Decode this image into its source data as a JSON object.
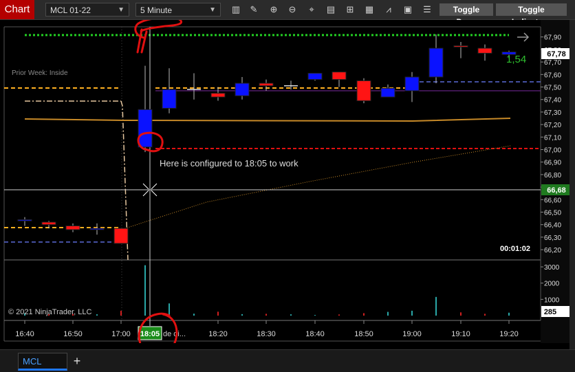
{
  "toolbar": {
    "chart_label": "Chart",
    "instrument": "MCL 01-22",
    "interval": "5 Minute",
    "toggle_draw_label": "Toggle Draw",
    "toggle_indicators_label": "Toggle Indicators",
    "icons": [
      "bar-type-icon",
      "pencil-icon",
      "zoom-in-icon",
      "zoom-out-icon",
      "crosshair-icon",
      "data-box-icon",
      "strategy-icon",
      "chart-style-icon",
      "properties-icon",
      "more-menu-icon"
    ]
  },
  "chart": {
    "prior_week_label": "Prior Week: Inside",
    "annotation": "Here is configured to 18:05 to work",
    "copyright": "© 2021 NinjaTrader, LLC",
    "countdown": "00:01:02",
    "cursor_time": "18:05",
    "cursor_time_suffix": "de di...",
    "change_value": "1,54",
    "price_labels": [
      "67,90",
      "67,80",
      "67,70",
      "67,60",
      "67,50",
      "67,40",
      "67,30",
      "67,20",
      "67,10",
      "67,00",
      "66,90",
      "66,80",
      "66,70",
      "66,60",
      "66,50",
      "66,40",
      "66,30",
      "66,20"
    ],
    "last_price": "67,78",
    "crosshair_price": "66,68",
    "volume_labels": [
      "3000",
      "2000",
      "1000"
    ],
    "volume_current": "285",
    "time_labels": [
      "16:40",
      "16:50",
      "17:00",
      "18:20",
      "18:30",
      "18:40",
      "18:50",
      "19:00",
      "19:10",
      "19:20"
    ],
    "colors": {
      "up": "#0a12ff",
      "down": "#ff1414",
      "last_price_badge": "#1f7a1f"
    }
  },
  "chart_data": {
    "type": "candlestick",
    "y_price_range": [
      66.14,
      67.97
    ],
    "candles": [
      {
        "o": 66.43,
        "h": 66.46,
        "l": 66.39,
        "c": 66.44
      },
      {
        "o": 66.42,
        "h": 66.43,
        "l": 66.37,
        "c": 66.4
      },
      {
        "o": 66.39,
        "h": 66.41,
        "l": 66.34,
        "c": 66.36
      },
      {
        "o": 66.36,
        "h": 66.41,
        "l": 66.32,
        "c": 66.37
      },
      {
        "o": 66.37,
        "h": 66.37,
        "l": 66.25,
        "c": 66.25
      },
      {
        "o": 67.02,
        "h": 67.67,
        "l": 66.98,
        "c": 67.32
      },
      {
        "o": 67.33,
        "h": 67.65,
        "l": 67.29,
        "c": 67.48
      },
      {
        "o": 67.48,
        "h": 67.61,
        "l": 67.4,
        "c": 67.48
      },
      {
        "o": 67.45,
        "h": 67.5,
        "l": 67.39,
        "c": 67.42
      },
      {
        "o": 67.43,
        "h": 67.58,
        "l": 67.4,
        "c": 67.53
      },
      {
        "o": 67.53,
        "h": 67.56,
        "l": 67.47,
        "c": 67.51
      },
      {
        "o": 67.51,
        "h": 67.55,
        "l": 67.48,
        "c": 67.51
      },
      {
        "o": 67.56,
        "h": 67.61,
        "l": 67.55,
        "c": 67.61
      },
      {
        "o": 67.62,
        "h": 67.62,
        "l": 67.5,
        "c": 67.56
      },
      {
        "o": 67.55,
        "h": 67.57,
        "l": 67.37,
        "c": 67.39
      },
      {
        "o": 67.42,
        "h": 67.52,
        "l": 67.42,
        "c": 67.49
      },
      {
        "o": 67.47,
        "h": 67.62,
        "l": 67.38,
        "c": 67.58
      },
      {
        "o": 67.58,
        "h": 67.92,
        "l": 67.53,
        "c": 67.81
      },
      {
        "o": 67.83,
        "h": 67.86,
        "l": 67.73,
        "c": 67.82
      },
      {
        "o": 67.81,
        "h": 67.84,
        "l": 67.71,
        "c": 67.77
      },
      {
        "o": 67.76,
        "h": 67.79,
        "l": 67.73,
        "c": 67.78
      }
    ],
    "volume": [
      150,
      90,
      110,
      80,
      300,
      3100,
      750,
      120,
      240,
      90,
      110,
      80,
      40,
      70,
      150,
      230,
      300,
      1150,
      200,
      110,
      180
    ],
    "volume_range": [
      0,
      3300
    ]
  }
}
